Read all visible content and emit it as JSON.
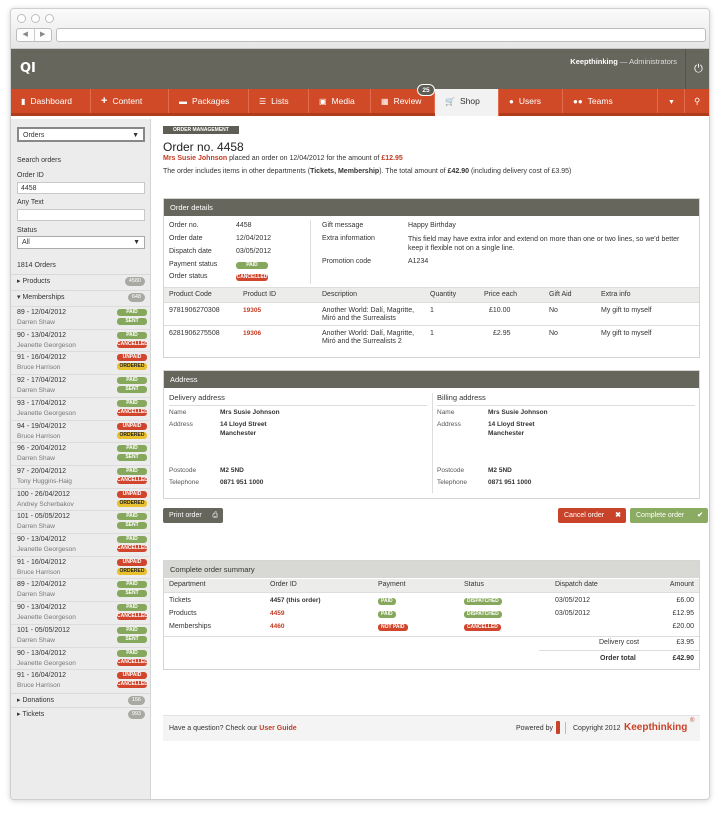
{
  "header": {
    "logo": "QI",
    "user_name": "Keepthinking",
    "user_sep": "—",
    "user_role": "Administrators"
  },
  "menu": [
    {
      "label": "Dashboard",
      "icon": "bookmark-icon"
    },
    {
      "label": "Content",
      "icon": "plus-icon"
    },
    {
      "label": "Packages",
      "icon": "box-icon"
    },
    {
      "label": "Lists",
      "icon": "list-icon"
    },
    {
      "label": "Media",
      "icon": "media-icon"
    },
    {
      "label": "Review",
      "icon": "calendar-icon",
      "badge": "25"
    },
    {
      "label": "Shop",
      "icon": "cart-icon"
    },
    {
      "label": "Users",
      "icon": "user-icon"
    },
    {
      "label": "Teams",
      "icon": "team-icon"
    }
  ],
  "sidebar": {
    "select": "Orders",
    "search_title": "Search orders",
    "order_id_label": "Order ID",
    "order_id_value": "4458",
    "any_text_label": "Any Text",
    "any_text_value": "",
    "status_label": "Status",
    "status_value": "All",
    "count": "1814 Orders",
    "cats": [
      {
        "label": "Products",
        "count": "4580"
      },
      {
        "label": "Memberships",
        "count": "648"
      }
    ],
    "orders": [
      {
        "date": "89 - 12/04/2012",
        "name": "Darren Shaw",
        "s1": "PAID",
        "c1": "g",
        "s2": "SENT",
        "c2": "g"
      },
      {
        "date": "90 - 13/04/2012",
        "name": "Jeanette Georgeson",
        "s1": "PAID",
        "c1": "g",
        "s2": "CANCELLED",
        "c2": "r"
      },
      {
        "date": "91 - 16/04/2012",
        "name": "Bruce Harrison",
        "s1": "UNPAID",
        "c1": "r",
        "s2": "ORDERED",
        "c2": "y"
      },
      {
        "date": "92 - 17/04/2012",
        "name": "Darren Shaw",
        "s1": "PAID",
        "c1": "g",
        "s2": "SENT",
        "c2": "g"
      },
      {
        "date": "93 - 17/04/2012",
        "name": "Jeanette Georgeson",
        "s1": "PAID",
        "c1": "g",
        "s2": "CANCELLED",
        "c2": "r"
      },
      {
        "date": "94 - 19/04/2012",
        "name": "Bruce Harrison",
        "s1": "UNPAID",
        "c1": "r",
        "s2": "ORDERED",
        "c2": "y"
      },
      {
        "date": "96 - 20/04/2012",
        "name": "Darren Shaw",
        "s1": "PAID",
        "c1": "g",
        "s2": "SENT",
        "c2": "g"
      },
      {
        "date": "97 - 20/04/2012",
        "name": "Tony Huggins-Haig",
        "s1": "PAID",
        "c1": "g",
        "s2": "CANCELLED",
        "c2": "r"
      },
      {
        "date": "100 - 26/04/2012",
        "name": "Andrey Scherbakov",
        "s1": "UNPAID",
        "c1": "r",
        "s2": "ORDERED",
        "c2": "y"
      },
      {
        "date": "101 - 05/05/2012",
        "name": "Darren Shaw",
        "s1": "PAID",
        "c1": "g",
        "s2": "SENT",
        "c2": "g"
      },
      {
        "date": "90 - 13/04/2012",
        "name": "Jeanette Georgeson",
        "s1": "PAID",
        "c1": "g",
        "s2": "CANCELLED",
        "c2": "r"
      },
      {
        "date": "91 - 16/04/2012",
        "name": "Bruce Harrison",
        "s1": "UNPAID",
        "c1": "r",
        "s2": "ORDERED",
        "c2": "y"
      },
      {
        "date": "89 - 12/04/2012",
        "name": "Darren Shaw",
        "s1": "PAID",
        "c1": "g",
        "s2": "SENT",
        "c2": "g"
      },
      {
        "date": "90 - 13/04/2012",
        "name": "Jeanette Georgeson",
        "s1": "PAID",
        "c1": "g",
        "s2": "CANCELLED",
        "c2": "r"
      },
      {
        "date": "101 - 05/05/2012",
        "name": "Darren Shaw",
        "s1": "PAID",
        "c1": "g",
        "s2": "SENT",
        "c2": "g"
      },
      {
        "date": "90 - 13/04/2012",
        "name": "Jeanette Georgeson",
        "s1": "PAID",
        "c1": "g",
        "s2": "CANCELLED",
        "c2": "r"
      },
      {
        "date": "91 - 16/04/2012",
        "name": "Bruce Harrison",
        "s1": "UNPAID",
        "c1": "r",
        "s2": "CANCELLED",
        "c2": "r"
      }
    ],
    "bottom_cats": [
      {
        "label": "Donations",
        "count": "156"
      },
      {
        "label": "Tickets",
        "count": "993"
      }
    ]
  },
  "main": {
    "crumb": "ORDER MANAGEMENT",
    "title": "Order no. 4458",
    "intro_name": "Mrs Susie Johnson",
    "intro_1": "placed an order on 12/04/2012 for the amount of",
    "intro_amount": "£12.95",
    "intro_2a": "The order includes items in other departments (",
    "intro_2b": "Tickets, Membership",
    "intro_2c": "). The total amount of",
    "intro_2d": "£42.90",
    "intro_2e": "(including delivery cost of £3.95)"
  },
  "details": {
    "title": "Order details",
    "order_no_label": "Order no.",
    "order_no": "4458",
    "order_date_label": "Order date",
    "order_date": "12/04/2012",
    "dispatch_label": "Dispatch date",
    "dispatch": "03/05/2012",
    "payment_label": "Payment status",
    "payment": "PAID",
    "status_label": "Order status",
    "status": "CANCELLED",
    "gift_label": "Gift message",
    "gift": "Happy Birthday",
    "extra_label": "Extra information",
    "extra": "This field may have extra infor and extend on more than one or two lines, so we'd better keep it flexible  not on a single line.",
    "promo_label": "Promotion code",
    "promo": "A1234",
    "cols": [
      "Product Code",
      "Product ID",
      "Description",
      "Quantity",
      "Price each",
      "Gift Aid",
      "Extra info"
    ],
    "rows": [
      {
        "code": "9781906270308",
        "id": "19305",
        "desc1": "Another World: Dalí, Magritte,",
        "desc2": "Miró and the Surrealists",
        "qty": "1",
        "price": "£10.00",
        "gift": "No",
        "info": "My gift to myself"
      },
      {
        "code": "6281906275508",
        "id": "19306",
        "desc1": "Another World: Dalí, Magritte,",
        "desc2": "Miró and the Surrealists 2",
        "qty": "1",
        "price": "£2.95",
        "gift": "No",
        "info": "My gift to myself"
      }
    ]
  },
  "address": {
    "title": "Address",
    "delivery_title": "Delivery address",
    "billing_title": "Billing address",
    "name_label": "Name",
    "address_label": "Address",
    "postcode_label": "Postcode",
    "tel_label": "Telephone",
    "name": "Mrs Susie Johnson",
    "line1": "14 Lloyd Street",
    "line2": "Manchester",
    "postcode": "M2 5ND",
    "tel": "0871 951 1000"
  },
  "actions": {
    "print": "Print order",
    "cancel": "Cancel order",
    "complete": "Complete order"
  },
  "summary": {
    "title": "Complete order summary",
    "cols": [
      "Department",
      "Order ID",
      "Payment",
      "Status",
      "Dispatch date",
      "Amount"
    ],
    "rows": [
      {
        "dept": "Tickets",
        "id": "4457 (this order)",
        "pay": "PAID",
        "payc": "g",
        "status": "DISPATCHED",
        "statc": "g",
        "date": "03/05/2012",
        "amount": "£6.00"
      },
      {
        "dept": "Products",
        "id": "4459",
        "pay": "PAID",
        "payc": "g",
        "status": "DISPATCHED",
        "statc": "g",
        "date": "03/05/2012",
        "amount": "£12.95"
      },
      {
        "dept": "Memberships",
        "id": "4460",
        "pay": "NOT PAID",
        "payc": "r",
        "status": "CANCELLED",
        "statc": "r",
        "date": "",
        "amount": "£20.00"
      }
    ],
    "delivery_label": "Delivery cost",
    "delivery": "£3.95",
    "total_label": "Order total",
    "total": "£42.90"
  },
  "footer": {
    "question": "Have a question? Check our",
    "guide": "User Guide",
    "powered": "Powered by",
    "copyright": "Copyright 2012",
    "brand": "Keepthinking",
    "reg": "®"
  }
}
